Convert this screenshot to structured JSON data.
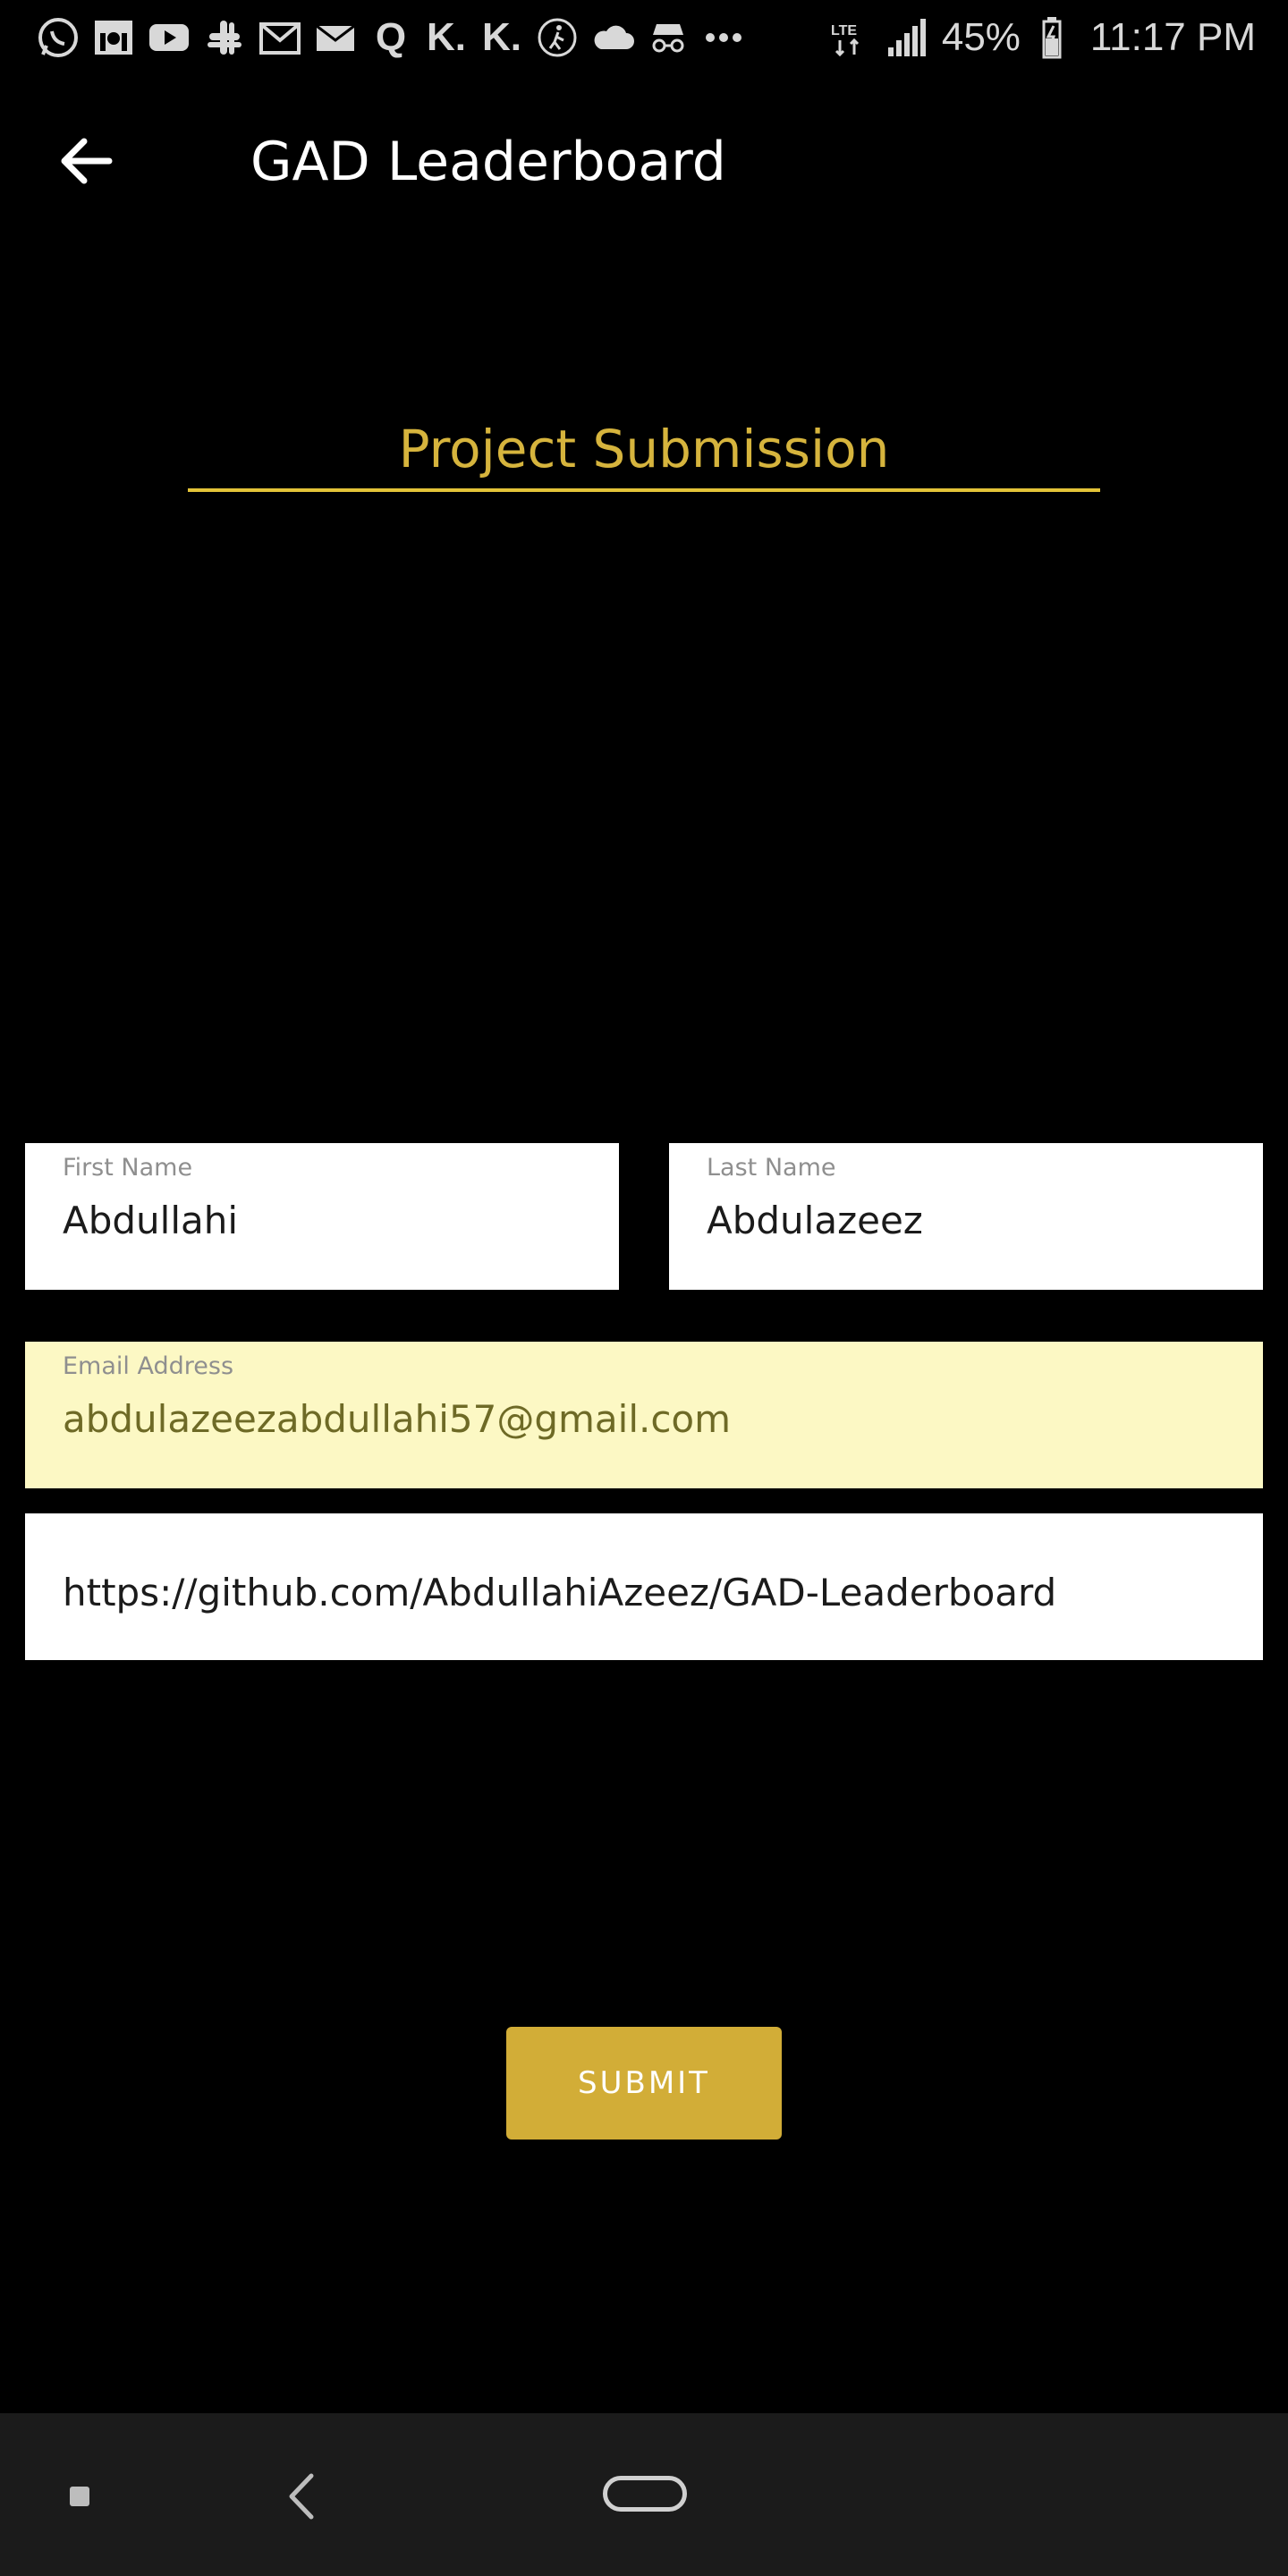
{
  "status_bar": {
    "icons": [
      "whatsapp-icon",
      "mosque-icon",
      "youtube-icon",
      "slack-icon",
      "gmail-icon",
      "mail-icon",
      "quora-icon",
      "k-icon",
      "k-icon",
      "walk-icon",
      "cloud-icon",
      "incognito-icon",
      "more-dots-icon"
    ],
    "battery": "45%",
    "time": "11:17 PM"
  },
  "app_bar": {
    "title": "GAD Leaderboard"
  },
  "heading": {
    "title": "Project Submission"
  },
  "form": {
    "first_name": {
      "label": "First Name",
      "value": "Abdullahi"
    },
    "last_name": {
      "label": "Last Name",
      "value": "Abdulazeez"
    },
    "email": {
      "label": "Email Address",
      "value": "abdulazeezabdullahi57@gmail.com"
    },
    "github": {
      "value": "https://github.com/AbdullahiAzeez/GAD-Leaderboard"
    },
    "submit_label": "SUBMIT"
  },
  "colors": {
    "accent": "#d6b43d",
    "button": "#d2ad37",
    "underline": "#e3c338",
    "autofill": "#fcf8c4",
    "background": "#000000"
  }
}
